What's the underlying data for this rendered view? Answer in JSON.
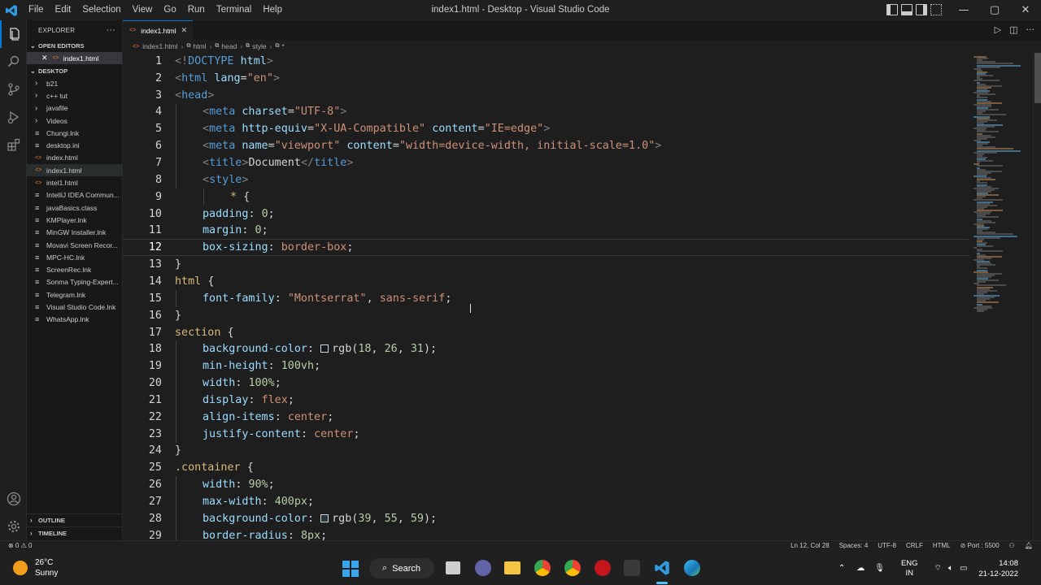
{
  "window": {
    "title": "index1.html - Desktop - Visual Studio Code",
    "menu": [
      "File",
      "Edit",
      "Selection",
      "View",
      "Go",
      "Run",
      "Terminal",
      "Help"
    ],
    "controls": [
      "—",
      "▢",
      "✕"
    ]
  },
  "sidebar": {
    "header": "EXPLORER",
    "more": "···",
    "open_editors_label": "OPEN EDITORS",
    "open_editor_file": "index1.html",
    "folder_label": "DESKTOP",
    "items": [
      {
        "name": "b21",
        "type": "folder"
      },
      {
        "name": "c++ tut",
        "type": "folder"
      },
      {
        "name": "javafile",
        "type": "folder"
      },
      {
        "name": "Videos",
        "type": "folder"
      },
      {
        "name": "Chungi.lnk",
        "type": "file"
      },
      {
        "name": "desktop.ini",
        "type": "file"
      },
      {
        "name": "index.html",
        "type": "html"
      },
      {
        "name": "index1.html",
        "type": "html"
      },
      {
        "name": "intel1.html",
        "type": "html"
      },
      {
        "name": "IntelliJ IDEA Commun...",
        "type": "file"
      },
      {
        "name": "javaBasics.class",
        "type": "file"
      },
      {
        "name": "KMPlayer.lnk",
        "type": "file"
      },
      {
        "name": "MinGW Installer.lnk",
        "type": "file"
      },
      {
        "name": "Movavi Screen Recor...",
        "type": "file"
      },
      {
        "name": "MPC-HC.lnk",
        "type": "file"
      },
      {
        "name": "ScreenRec.lnk",
        "type": "file"
      },
      {
        "name": "Sonma Typing-Expert...",
        "type": "file"
      },
      {
        "name": "Telegram.lnk",
        "type": "file"
      },
      {
        "name": "Visual Studio Code.lnk",
        "type": "file"
      },
      {
        "name": "WhatsApp.lnk",
        "type": "file"
      }
    ],
    "outline_label": "OUTLINE",
    "timeline_label": "TIMELINE"
  },
  "tab": {
    "label": "index1.html"
  },
  "breadcrumb": [
    "index1.html",
    "html",
    "head",
    "style",
    "*"
  ],
  "editor": {
    "current_line": 12,
    "lines": [
      {
        "n": "1",
        "indent": 0,
        "tokens": [
          [
            "t-tag",
            "<!"
          ],
          [
            "t-kw",
            "DOCTYPE"
          ],
          [
            "t-plain",
            " "
          ],
          [
            "t-attr",
            "html"
          ],
          [
            "t-tag",
            ">"
          ]
        ]
      },
      {
        "n": "2",
        "indent": 0,
        "tokens": [
          [
            "t-tag",
            "<"
          ],
          [
            "t-name",
            "html"
          ],
          [
            "t-plain",
            " "
          ],
          [
            "t-attr",
            "lang"
          ],
          [
            "t-plain",
            "="
          ],
          [
            "t-str",
            "\"en\""
          ],
          [
            "t-tag",
            ">"
          ]
        ]
      },
      {
        "n": "3",
        "indent": 0,
        "tokens": [
          [
            "t-tag",
            "<"
          ],
          [
            "t-name",
            "head"
          ],
          [
            "t-tag",
            ">"
          ]
        ]
      },
      {
        "n": "4",
        "indent": 1,
        "tokens": [
          [
            "t-tag",
            "<"
          ],
          [
            "t-name",
            "meta"
          ],
          [
            "t-plain",
            " "
          ],
          [
            "t-attr",
            "charset"
          ],
          [
            "t-plain",
            "="
          ],
          [
            "t-str",
            "\"UTF-8\""
          ],
          [
            "t-tag",
            ">"
          ]
        ]
      },
      {
        "n": "5",
        "indent": 1,
        "tokens": [
          [
            "t-tag",
            "<"
          ],
          [
            "t-name",
            "meta"
          ],
          [
            "t-plain",
            " "
          ],
          [
            "t-attr",
            "http-equiv"
          ],
          [
            "t-plain",
            "="
          ],
          [
            "t-str",
            "\"X-UA-Compatible\""
          ],
          [
            "t-plain",
            " "
          ],
          [
            "t-attr",
            "content"
          ],
          [
            "t-plain",
            "="
          ],
          [
            "t-str",
            "\"IE=edge\""
          ],
          [
            "t-tag",
            ">"
          ]
        ]
      },
      {
        "n": "6",
        "indent": 1,
        "tokens": [
          [
            "t-tag",
            "<"
          ],
          [
            "t-name",
            "meta"
          ],
          [
            "t-plain",
            " "
          ],
          [
            "t-attr",
            "name"
          ],
          [
            "t-plain",
            "="
          ],
          [
            "t-str",
            "\"viewport\""
          ],
          [
            "t-plain",
            " "
          ],
          [
            "t-attr",
            "content"
          ],
          [
            "t-plain",
            "="
          ],
          [
            "t-str",
            "\"width=device-width, initial-scale=1.0\""
          ],
          [
            "t-tag",
            ">"
          ]
        ]
      },
      {
        "n": "7",
        "indent": 1,
        "tokens": [
          [
            "t-tag",
            "<"
          ],
          [
            "t-name",
            "title"
          ],
          [
            "t-tag",
            ">"
          ],
          [
            "t-txt",
            "Document"
          ],
          [
            "t-tag",
            "</"
          ],
          [
            "t-name",
            "title"
          ],
          [
            "t-tag",
            ">"
          ]
        ]
      },
      {
        "n": "8",
        "indent": 1,
        "tokens": [
          [
            "t-tag",
            "<"
          ],
          [
            "t-name",
            "style"
          ],
          [
            "t-tag",
            ">"
          ]
        ]
      },
      {
        "n": "9",
        "indent": 2,
        "tokens": [
          [
            "t-sel",
            "* "
          ],
          [
            "t-plain",
            "{"
          ]
        ]
      },
      {
        "n": "10",
        "indent": 1,
        "tokens": [
          [
            "t-prop",
            "padding"
          ],
          [
            "t-plain",
            ": "
          ],
          [
            "t-num",
            "0"
          ],
          [
            "t-plain",
            ";"
          ]
        ]
      },
      {
        "n": "11",
        "indent": 1,
        "tokens": [
          [
            "t-prop",
            "margin"
          ],
          [
            "t-plain",
            ": "
          ],
          [
            "t-num",
            "0"
          ],
          [
            "t-plain",
            ";"
          ]
        ]
      },
      {
        "n": "12",
        "indent": 1,
        "tokens": [
          [
            "t-prop",
            "box-sizing"
          ],
          [
            "t-plain",
            ": "
          ],
          [
            "t-str",
            "border-box"
          ],
          [
            "t-plain",
            ";"
          ]
        ]
      },
      {
        "n": "13",
        "indent": 0,
        "tokens": [
          [
            "t-plain",
            "}"
          ]
        ]
      },
      {
        "n": "14",
        "indent": 0,
        "tokens": [
          [
            "t-sel",
            "html "
          ],
          [
            "t-plain",
            "{"
          ]
        ]
      },
      {
        "n": "15",
        "indent": 1,
        "tokens": [
          [
            "t-prop",
            "font-family"
          ],
          [
            "t-plain",
            ": "
          ],
          [
            "t-str",
            "\"Montserrat\""
          ],
          [
            "t-plain",
            ", "
          ],
          [
            "t-str",
            "sans-serif"
          ],
          [
            "t-plain",
            ";"
          ]
        ]
      },
      {
        "n": "16",
        "indent": 0,
        "tokens": [
          [
            "t-plain",
            "}"
          ]
        ]
      },
      {
        "n": "17",
        "indent": 0,
        "tokens": [
          [
            "t-sel",
            "section "
          ],
          [
            "t-plain",
            "{"
          ]
        ]
      },
      {
        "n": "18",
        "indent": 1,
        "tokens": [
          [
            "t-prop",
            "background-color"
          ],
          [
            "t-plain",
            ": "
          ],
          [
            "t-swatch",
            "rgb(18, 26, 31)"
          ],
          [
            "t-plain",
            "rgb("
          ],
          [
            "t-num",
            "18"
          ],
          [
            "t-plain",
            ", "
          ],
          [
            "t-num",
            "26"
          ],
          [
            "t-plain",
            ", "
          ],
          [
            "t-num",
            "31"
          ],
          [
            "t-plain",
            ");"
          ]
        ]
      },
      {
        "n": "19",
        "indent": 1,
        "tokens": [
          [
            "t-prop",
            "min-height"
          ],
          [
            "t-plain",
            ": "
          ],
          [
            "t-num",
            "100vh"
          ],
          [
            "t-plain",
            ";"
          ]
        ]
      },
      {
        "n": "20",
        "indent": 1,
        "tokens": [
          [
            "t-prop",
            "width"
          ],
          [
            "t-plain",
            ": "
          ],
          [
            "t-num",
            "100%"
          ],
          [
            "t-plain",
            ";"
          ]
        ]
      },
      {
        "n": "21",
        "indent": 1,
        "tokens": [
          [
            "t-prop",
            "display"
          ],
          [
            "t-plain",
            ": "
          ],
          [
            "t-str",
            "flex"
          ],
          [
            "t-plain",
            ";"
          ]
        ]
      },
      {
        "n": "22",
        "indent": 1,
        "tokens": [
          [
            "t-prop",
            "align-items"
          ],
          [
            "t-plain",
            ": "
          ],
          [
            "t-str",
            "center"
          ],
          [
            "t-plain",
            ";"
          ]
        ]
      },
      {
        "n": "23",
        "indent": 1,
        "tokens": [
          [
            "t-prop",
            "justify-content"
          ],
          [
            "t-plain",
            ": "
          ],
          [
            "t-str",
            "center"
          ],
          [
            "t-plain",
            ";"
          ]
        ]
      },
      {
        "n": "24",
        "indent": 0,
        "tokens": [
          [
            "t-plain",
            "}"
          ]
        ]
      },
      {
        "n": "25",
        "indent": 0,
        "tokens": [
          [
            "t-sel",
            ".container "
          ],
          [
            "t-plain",
            "{"
          ]
        ]
      },
      {
        "n": "26",
        "indent": 1,
        "tokens": [
          [
            "t-prop",
            "width"
          ],
          [
            "t-plain",
            ": "
          ],
          [
            "t-num",
            "90%"
          ],
          [
            "t-plain",
            ";"
          ]
        ]
      },
      {
        "n": "27",
        "indent": 1,
        "tokens": [
          [
            "t-prop",
            "max-width"
          ],
          [
            "t-plain",
            ": "
          ],
          [
            "t-num",
            "400px"
          ],
          [
            "t-plain",
            ";"
          ]
        ]
      },
      {
        "n": "28",
        "indent": 1,
        "tokens": [
          [
            "t-prop",
            "background-color"
          ],
          [
            "t-plain",
            ": "
          ],
          [
            "t-swatch",
            "rgb(39, 55, 59)"
          ],
          [
            "t-plain",
            "rgb("
          ],
          [
            "t-num",
            "39"
          ],
          [
            "t-plain",
            ", "
          ],
          [
            "t-num",
            "55"
          ],
          [
            "t-plain",
            ", "
          ],
          [
            "t-num",
            "59"
          ],
          [
            "t-plain",
            ");"
          ]
        ]
      },
      {
        "n": "29",
        "indent": 1,
        "tokens": [
          [
            "t-prop",
            "border-radius"
          ],
          [
            "t-plain",
            ": "
          ],
          [
            "t-num",
            "8px"
          ],
          [
            "t-plain",
            ";"
          ]
        ]
      }
    ]
  },
  "statusbar": {
    "problems": "⊗ 0 ⚠ 0",
    "position": "Ln 12, Col 28",
    "spaces": "Spaces: 4",
    "encoding": "UTF-8",
    "eol": "CRLF",
    "language": "HTML",
    "port": "⊘ Port : 5500"
  },
  "taskbar": {
    "temp": "26°C",
    "weather": "Sunny",
    "search_label": "Search",
    "lang_top": "ENG",
    "lang_bottom": "IN",
    "time": "14:08",
    "date": "21-12-2022"
  },
  "colors": {
    "accent": "#0078d4",
    "tag": "#808080",
    "keyword": "#569cd6",
    "string": "#ce9178",
    "property": "#9cdcfe",
    "number": "#b5cea8",
    "selector": "#d7ba7d"
  },
  "icons": [
    "vscode-logo-icon",
    "explorer-icon",
    "search-icon",
    "source-control-icon",
    "run-debug-icon",
    "extensions-icon",
    "account-icon",
    "settings-gear-icon",
    "windows-start-icon",
    "edge-icon",
    "chrome-icon"
  ]
}
